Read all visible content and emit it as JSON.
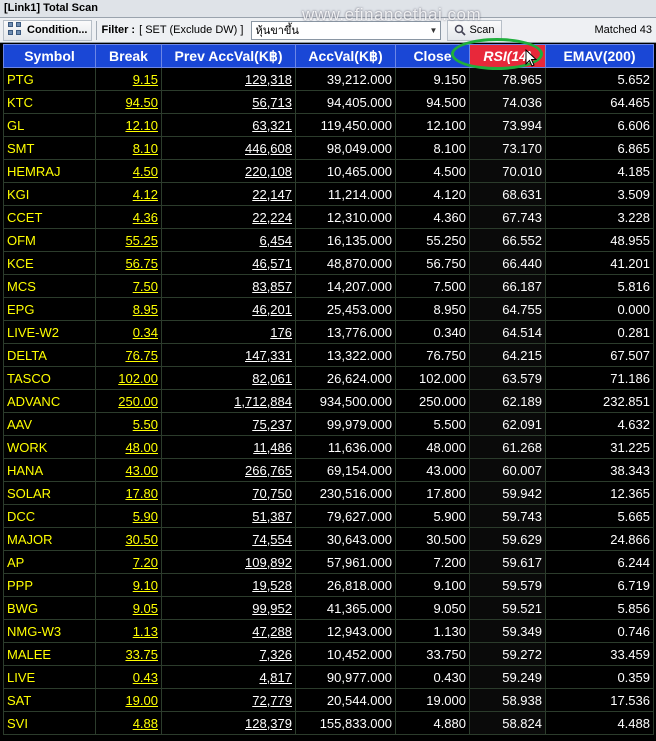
{
  "window": {
    "title": "[Link1] Total Scan"
  },
  "toolbar": {
    "condition_label": "Condition...",
    "filter_label": "Filter :",
    "filter_value": "[ SET (Exclude DW) ]",
    "combo_value": "หุ้นขาขึ้น",
    "scan_label": "Scan",
    "matched_label": "Matched 43"
  },
  "watermark": "www.efinancethai.com",
  "columns": [
    "Symbol",
    "Break",
    "Prev AccVal(K฿)",
    "AccVal(K฿)",
    "Close",
    "RSI(14)",
    "EMAV(200)"
  ],
  "rows": [
    [
      "PTG",
      "9.15",
      "129,318",
      "39,212.000",
      "9.150",
      "78.965",
      "5.652"
    ],
    [
      "KTC",
      "94.50",
      "56,713",
      "94,405.000",
      "94.500",
      "74.036",
      "64.465"
    ],
    [
      "GL",
      "12.10",
      "63,321",
      "119,450.000",
      "12.100",
      "73.994",
      "6.606"
    ],
    [
      "SMT",
      "8.10",
      "446,608",
      "98,049.000",
      "8.100",
      "73.170",
      "6.865"
    ],
    [
      "HEMRAJ",
      "4.50",
      "220,108",
      "10,465.000",
      "4.500",
      "70.010",
      "4.185"
    ],
    [
      "KGI",
      "4.12",
      "22,147",
      "11,214.000",
      "4.120",
      "68.631",
      "3.509"
    ],
    [
      "CCET",
      "4.36",
      "22,224",
      "12,310.000",
      "4.360",
      "67.743",
      "3.228"
    ],
    [
      "OFM",
      "55.25",
      "6,454",
      "16,135.000",
      "55.250",
      "66.552",
      "48.955"
    ],
    [
      "KCE",
      "56.75",
      "46,571",
      "48,870.000",
      "56.750",
      "66.440",
      "41.201"
    ],
    [
      "MCS",
      "7.50",
      "83,857",
      "14,207.000",
      "7.500",
      "66.187",
      "5.816"
    ],
    [
      "EPG",
      "8.95",
      "46,201",
      "25,453.000",
      "8.950",
      "64.755",
      "0.000"
    ],
    [
      "LIVE-W2",
      "0.34",
      "176",
      "13,776.000",
      "0.340",
      "64.514",
      "0.281"
    ],
    [
      "DELTA",
      "76.75",
      "147,331",
      "13,322.000",
      "76.750",
      "64.215",
      "67.507"
    ],
    [
      "TASCO",
      "102.00",
      "82,061",
      "26,624.000",
      "102.000",
      "63.579",
      "71.186"
    ],
    [
      "ADVANC",
      "250.00",
      "1,712,884",
      "934,500.000",
      "250.000",
      "62.189",
      "232.851"
    ],
    [
      "AAV",
      "5.50",
      "75,237",
      "99,979.000",
      "5.500",
      "62.091",
      "4.632"
    ],
    [
      "WORK",
      "48.00",
      "11,486",
      "11,636.000",
      "48.000",
      "61.268",
      "31.225"
    ],
    [
      "HANA",
      "43.00",
      "266,765",
      "69,154.000",
      "43.000",
      "60.007",
      "38.343"
    ],
    [
      "SOLAR",
      "17.80",
      "70,750",
      "230,516.000",
      "17.800",
      "59.942",
      "12.365"
    ],
    [
      "DCC",
      "5.90",
      "51,387",
      "79,627.000",
      "5.900",
      "59.743",
      "5.665"
    ],
    [
      "MAJOR",
      "30.50",
      "74,554",
      "30,643.000",
      "30.500",
      "59.629",
      "24.866"
    ],
    [
      "AP",
      "7.20",
      "109,892",
      "57,961.000",
      "7.200",
      "59.617",
      "6.244"
    ],
    [
      "PPP",
      "9.10",
      "19,528",
      "26,818.000",
      "9.100",
      "59.579",
      "6.719"
    ],
    [
      "BWG",
      "9.05",
      "99,952",
      "41,365.000",
      "9.050",
      "59.521",
      "5.856"
    ],
    [
      "NMG-W3",
      "1.13",
      "47,288",
      "12,943.000",
      "1.130",
      "59.349",
      "0.746"
    ],
    [
      "MALEE",
      "33.75",
      "7,326",
      "10,452.000",
      "33.750",
      "59.272",
      "33.459"
    ],
    [
      "LIVE",
      "0.43",
      "4,817",
      "90,977.000",
      "0.430",
      "59.249",
      "0.359"
    ],
    [
      "SAT",
      "19.00",
      "72,779",
      "20,544.000",
      "19.000",
      "58.938",
      "17.536"
    ],
    [
      "SVI",
      "4.88",
      "128,379",
      "155,833.000",
      "4.880",
      "58.824",
      "4.488"
    ]
  ],
  "colors": {
    "header_bg": "#1a47d6",
    "rsi_header_bg": "#e8283a",
    "symbol_text": "#ffff00",
    "highlight_circle": "#1fae3c"
  }
}
